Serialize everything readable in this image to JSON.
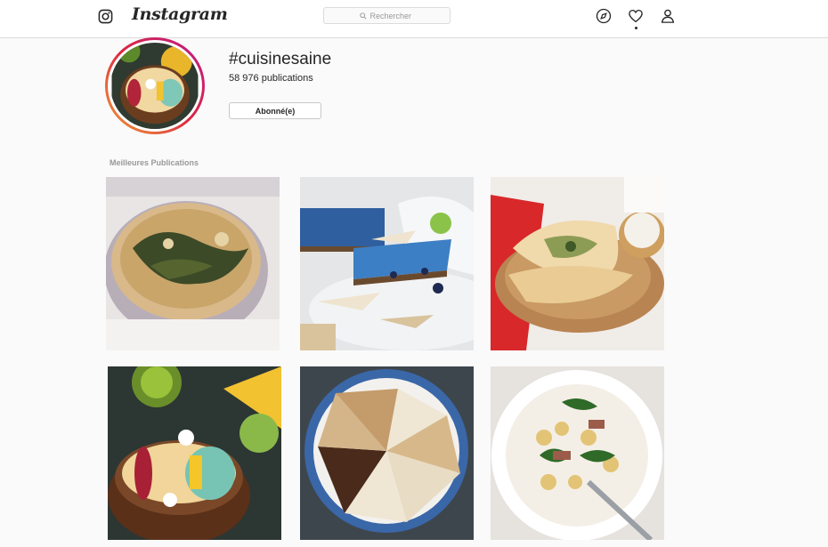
{
  "nav": {
    "brand": "Instagram",
    "search_placeholder": "Rechercher",
    "icons": [
      "instagram-glyph-icon",
      "search-icon",
      "explore-compass-icon",
      "activity-heart-icon",
      "profile-user-icon"
    ]
  },
  "header": {
    "hashtag": "#cuisinesaine",
    "publications": "58 976 publications",
    "follow_label": "Abonné(e)"
  },
  "section": {
    "title": "Meilleures Publications"
  },
  "posts": [
    {
      "subject": "spinach quiche"
    },
    {
      "subject": "blue spirulina cheesecake with coconut chips"
    },
    {
      "subject": "stuffed flatbreads"
    },
    {
      "subject": "smoothie bowl in coconut shell"
    },
    {
      "subject": "crepe cake slices"
    },
    {
      "subject": "gnocchi salad bowl"
    }
  ],
  "colors": {
    "accent_gradient": [
      "#f09433",
      "#e6683c",
      "#dc2743",
      "#cc2366",
      "#bc1888"
    ],
    "border": "#dbdbdb",
    "text": "#262626",
    "muted": "#999999"
  }
}
